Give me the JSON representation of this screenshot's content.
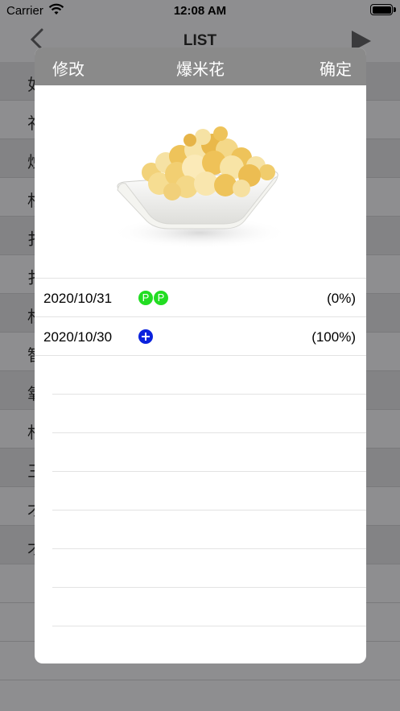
{
  "status_bar": {
    "carrier": "Carrier",
    "time": "12:08 AM"
  },
  "background": {
    "nav_title": "LIST",
    "rows": [
      "如",
      "祁",
      "烛",
      "杉",
      "扌",
      "扌",
      "杉",
      "智",
      "氧",
      "杉",
      "三",
      "才",
      "才"
    ]
  },
  "modal": {
    "left_button": "修改",
    "title": "爆米花",
    "right_button": "确定",
    "image": "popcorn-bowl-image",
    "entries": [
      {
        "date": "2020/10/31",
        "badges": [
          "P",
          "P"
        ],
        "badge_type": "p",
        "percent": "(0%)"
      },
      {
        "date": "2020/10/30",
        "badges": [
          "+"
        ],
        "badge_type": "plus",
        "percent": "(100%)"
      }
    ]
  },
  "colors": {
    "badge_green": "#22dd22",
    "badge_blue": "#0a22dd",
    "header_gray": "#8a8a8a"
  }
}
